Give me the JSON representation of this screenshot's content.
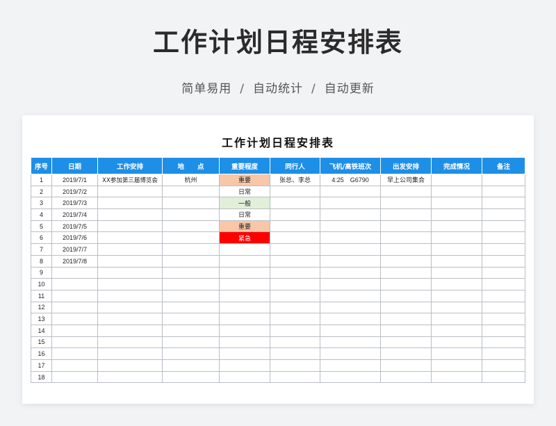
{
  "page": {
    "title": "工作计划日程安排表",
    "subtitle_parts": [
      "简单易用",
      "/",
      "自动统计",
      "/",
      "自动更新"
    ]
  },
  "sheet": {
    "title": "工作计划日程安排表",
    "headers": [
      "序号",
      "日期",
      "工作安排",
      "地　　点",
      "重要程度",
      "同行人",
      "飞机/高铁班次",
      "出发安排",
      "完成情况",
      "备注"
    ],
    "rows": [
      {
        "no": "1",
        "date": "2019/7/1",
        "task": "XX参加第三届博览会",
        "place": "杭州",
        "priority": "重要",
        "priority_level": "important",
        "companions": "张总、李总",
        "transport": "4:25　G6790",
        "departure": "早上公司集合",
        "status": "",
        "note": ""
      },
      {
        "no": "2",
        "date": "2019/7/2",
        "task": "",
        "place": "",
        "priority": "日常",
        "priority_level": "normal",
        "companions": "",
        "transport": "",
        "departure": "",
        "status": "",
        "note": ""
      },
      {
        "no": "3",
        "date": "2019/7/3",
        "task": "",
        "place": "",
        "priority": "一般",
        "priority_level": "general",
        "companions": "",
        "transport": "",
        "departure": "",
        "status": "",
        "note": ""
      },
      {
        "no": "4",
        "date": "2019/7/4",
        "task": "",
        "place": "",
        "priority": "日常",
        "priority_level": "normal",
        "companions": "",
        "transport": "",
        "departure": "",
        "status": "",
        "note": ""
      },
      {
        "no": "5",
        "date": "2019/7/5",
        "task": "",
        "place": "",
        "priority": "重要",
        "priority_level": "important",
        "companions": "",
        "transport": "",
        "departure": "",
        "status": "",
        "note": ""
      },
      {
        "no": "6",
        "date": "2019/7/6",
        "task": "",
        "place": "",
        "priority": "紧急",
        "priority_level": "urgent",
        "companions": "",
        "transport": "",
        "departure": "",
        "status": "",
        "note": ""
      },
      {
        "no": "7",
        "date": "2019/7/7",
        "task": "",
        "place": "",
        "priority": "",
        "priority_level": "",
        "companions": "",
        "transport": "",
        "departure": "",
        "status": "",
        "note": ""
      },
      {
        "no": "8",
        "date": "2019/7/8",
        "task": "",
        "place": "",
        "priority": "",
        "priority_level": "",
        "companions": "",
        "transport": "",
        "departure": "",
        "status": "",
        "note": ""
      },
      {
        "no": "9",
        "date": "",
        "task": "",
        "place": "",
        "priority": "",
        "priority_level": "",
        "companions": "",
        "transport": "",
        "departure": "",
        "status": "",
        "note": ""
      },
      {
        "no": "10",
        "date": "",
        "task": "",
        "place": "",
        "priority": "",
        "priority_level": "",
        "companions": "",
        "transport": "",
        "departure": "",
        "status": "",
        "note": ""
      },
      {
        "no": "11",
        "date": "",
        "task": "",
        "place": "",
        "priority": "",
        "priority_level": "",
        "companions": "",
        "transport": "",
        "departure": "",
        "status": "",
        "note": ""
      },
      {
        "no": "12",
        "date": "",
        "task": "",
        "place": "",
        "priority": "",
        "priority_level": "",
        "companions": "",
        "transport": "",
        "departure": "",
        "status": "",
        "note": ""
      },
      {
        "no": "13",
        "date": "",
        "task": "",
        "place": "",
        "priority": "",
        "priority_level": "",
        "companions": "",
        "transport": "",
        "departure": "",
        "status": "",
        "note": ""
      },
      {
        "no": "14",
        "date": "",
        "task": "",
        "place": "",
        "priority": "",
        "priority_level": "",
        "companions": "",
        "transport": "",
        "departure": "",
        "status": "",
        "note": ""
      },
      {
        "no": "15",
        "date": "",
        "task": "",
        "place": "",
        "priority": "",
        "priority_level": "",
        "companions": "",
        "transport": "",
        "departure": "",
        "status": "",
        "note": ""
      },
      {
        "no": "16",
        "date": "",
        "task": "",
        "place": "",
        "priority": "",
        "priority_level": "",
        "companions": "",
        "transport": "",
        "departure": "",
        "status": "",
        "note": ""
      },
      {
        "no": "17",
        "date": "",
        "task": "",
        "place": "",
        "priority": "",
        "priority_level": "",
        "companions": "",
        "transport": "",
        "departure": "",
        "status": "",
        "note": ""
      },
      {
        "no": "18",
        "date": "",
        "task": "",
        "place": "",
        "priority": "",
        "priority_level": "",
        "companions": "",
        "transport": "",
        "departure": "",
        "status": "",
        "note": ""
      }
    ]
  },
  "colors": {
    "header_bg": "#1e8fe6",
    "important": "#f7c7a8",
    "general": "#e2efd9",
    "urgent": "#ff0000"
  }
}
